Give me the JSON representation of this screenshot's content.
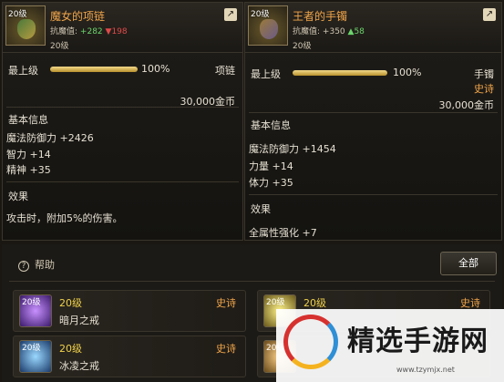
{
  "left": {
    "name": "魔女的项链",
    "level_badge": "20级",
    "resist_label": "抗魔值:",
    "resist_up": "+282",
    "resist_down": "▼198",
    "level": "20级",
    "max_label": "最上级",
    "max_pct_value": 1.0,
    "max_pct_text": "100%",
    "slot": "项链",
    "price": "30,000金币",
    "basic_title": "基本信息",
    "stats": [
      "魔法防御力 +2426",
      "智力 +14",
      "精神 +35"
    ],
    "effect_title": "效果",
    "effect_text": "攻击时，附加5%的伤害。"
  },
  "right": {
    "name": "王者的手镯",
    "level_badge": "20级",
    "resist_label": "抗魔值:",
    "resist_up1": "+350",
    "resist_up2": "▲58",
    "level": "20级",
    "max_label": "最上级",
    "max_pct_value": 1.0,
    "max_pct_text": "100%",
    "slot": "手镯",
    "rarity": "史诗",
    "price": "30,000金币",
    "basic_title": "基本信息",
    "stats": [
      "魔法防御力 +1454",
      "力量 +14",
      "体力 +35"
    ],
    "effect_title": "效果",
    "effect_text": "全属性强化 +7"
  },
  "bottom": {
    "help_label": "帮助",
    "all_button": "全部",
    "cards": [
      {
        "badge": "20级",
        "level": "20级",
        "name": "暗月之戒",
        "rarity": "史诗",
        "color": "#7a3ad6"
      },
      {
        "badge": "20级",
        "level": "20级",
        "name": "",
        "rarity": "史诗",
        "color": "#d6c23a"
      },
      {
        "badge": "20级",
        "level": "20级",
        "name": "冰凌之戒",
        "rarity": "史诗",
        "color": "#3a8fd6"
      },
      {
        "badge": "20级",
        "level": "",
        "name": "",
        "rarity": "",
        "color": "#d6a23a"
      }
    ]
  },
  "watermark": {
    "text": "精选手游网",
    "url": "www.tzymjx.net"
  }
}
